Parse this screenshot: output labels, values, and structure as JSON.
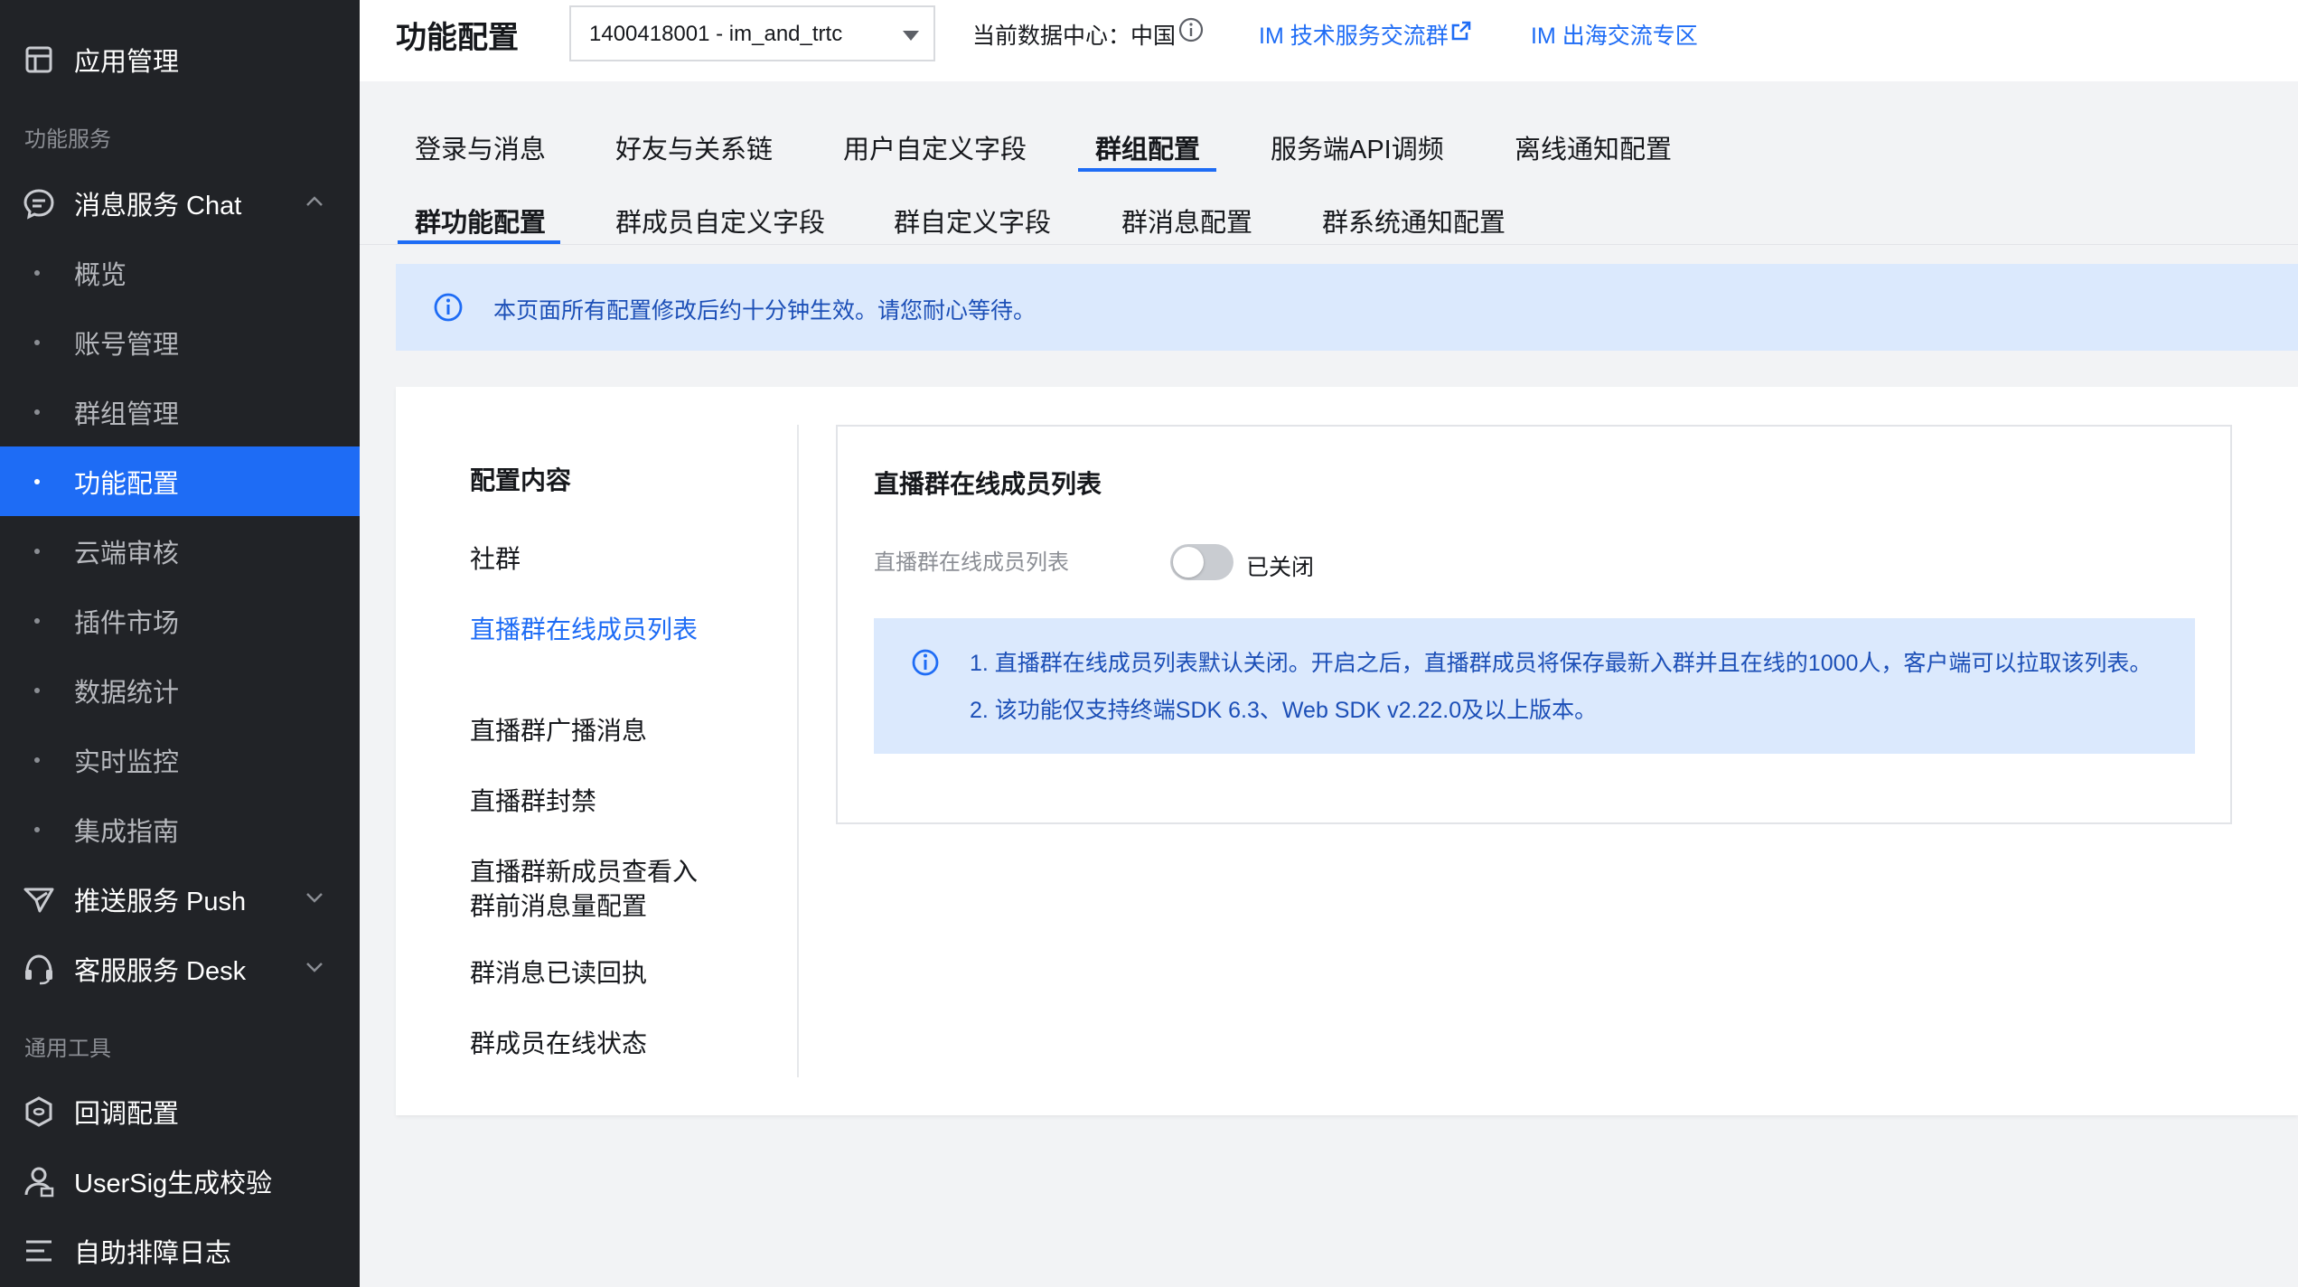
{
  "sidebar": {
    "app_manage": "应用管理",
    "section_services": "功能服务",
    "chat_service": "消息服务 Chat",
    "chat_items": [
      "概览",
      "账号管理",
      "群组管理",
      "功能配置",
      "云端审核",
      "插件市场",
      "数据统计",
      "实时监控",
      "集成指南"
    ],
    "active_item": "功能配置",
    "push_service": "推送服务 Push",
    "desk_service": "客服服务 Desk",
    "section_tools": "通用工具",
    "tools": [
      "回调配置",
      "UserSig生成校验",
      "自助排障日志"
    ]
  },
  "topbar": {
    "title": "功能配置",
    "app_select": "1400418001 - im_and_trtc",
    "datacenter": "当前数据中心：中国",
    "link_tech": "IM 技术服务交流群",
    "link_overseas": "IM 出海交流专区"
  },
  "tabs": [
    "登录与消息",
    "好友与关系链",
    "用户自定义字段",
    "群组配置",
    "服务端API调频",
    "离线通知配置"
  ],
  "active_tab": "群组配置",
  "subtabs": [
    "群功能配置",
    "群成员自定义字段",
    "群自定义字段",
    "群消息配置",
    "群系统通知配置"
  ],
  "active_subtab": "群功能配置",
  "notice": "本页面所有配置修改后约十分钟生效。请您耐心等待。",
  "config_nav": {
    "title": "配置内容",
    "items": [
      "社群",
      "直播群在线成员列表",
      "直播群广播消息",
      "直播群封禁",
      "直播群新成员查看入群前消息量配置",
      "群消息已读回执",
      "群成员在线状态"
    ],
    "active": "直播群在线成员列表"
  },
  "panel": {
    "title": "直播群在线成员列表",
    "field_label": "直播群在线成员列表",
    "toggle_on": false,
    "toggle_state": "已关闭",
    "notes": [
      "1. 直播群在线成员列表默认关闭。开启之后，直播群成员将保存最新入群并且在线的1000人，客户端可以拉取该列表。",
      "2. 该功能仅支持终端SDK 6.3、Web SDK v2.22.0及以上版本。"
    ]
  },
  "colors": {
    "sidebar_bg": "#212327",
    "accent": "#1e6cf5",
    "notice_bg": "#dbe9fd",
    "notice_text": "#1c4fb7"
  }
}
